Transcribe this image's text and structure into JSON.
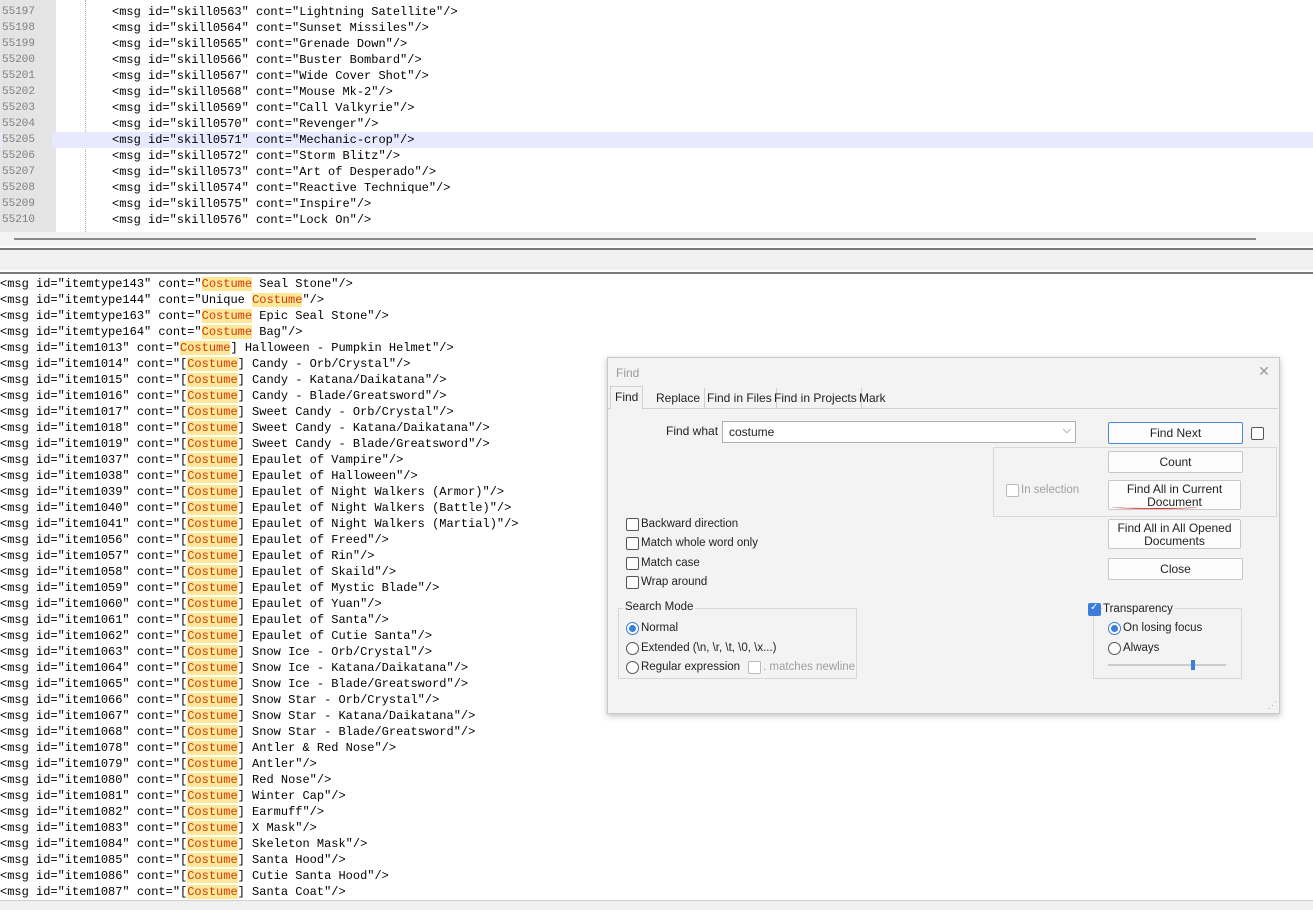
{
  "top_editor": {
    "current_line_index": 8,
    "lines": [
      {
        "num": "55197",
        "code": "<msg id=\"skill0563\" cont=\"Lightning Satellite\"/>"
      },
      {
        "num": "55198",
        "code": "<msg id=\"skill0564\" cont=\"Sunset Missiles\"/>"
      },
      {
        "num": "55199",
        "code": "<msg id=\"skill0565\" cont=\"Grenade Down\"/>"
      },
      {
        "num": "55200",
        "code": "<msg id=\"skill0566\" cont=\"Buster Bombard\"/>"
      },
      {
        "num": "55201",
        "code": "<msg id=\"skill0567\" cont=\"Wide Cover Shot\"/>"
      },
      {
        "num": "55202",
        "code": "<msg id=\"skill0568\" cont=\"Mouse Mk-2\"/>"
      },
      {
        "num": "55203",
        "code": "<msg id=\"skill0569\" cont=\"Call Valkyrie\"/>"
      },
      {
        "num": "55204",
        "code": "<msg id=\"skill0570\" cont=\"Revenger\"/>"
      },
      {
        "num": "55205",
        "code": "<msg id=\"skill0571\" cont=\"Mechanic-crop\"/>"
      },
      {
        "num": "55206",
        "code": "<msg id=\"skill0572\" cont=\"Storm Blitz\"/>"
      },
      {
        "num": "55207",
        "code": "<msg id=\"skill0573\" cont=\"Art of Desperado\"/>"
      },
      {
        "num": "55208",
        "code": "<msg id=\"skill0574\" cont=\"Reactive Technique\"/>"
      },
      {
        "num": "55209",
        "code": "<msg id=\"skill0575\" cont=\"Inspire\"/>"
      },
      {
        "num": "55210",
        "code": "<msg id=\"skill0576\" cont=\"Lock On\"/>"
      }
    ]
  },
  "results": {
    "lines": [
      {
        "pre": "<msg id=\"itemtype143\" cont=\"",
        "match": "Costume",
        "post": " Seal Stone\"/>"
      },
      {
        "pre": "<msg id=\"itemtype144\" cont=\"Unique ",
        "match": "Costume",
        "post": "\"/>"
      },
      {
        "pre": "<msg id=\"itemtype163\" cont=\"",
        "match": "Costume",
        "post": " Epic Seal Stone\"/>"
      },
      {
        "pre": "<msg id=\"itemtype164\" cont=\"",
        "match": "Costume",
        "post": " Bag\"/>"
      },
      {
        "pre": "<msg id=\"item1013\" cont=\"",
        "match": "Costume",
        "post": "] Halloween - Pumpkin Helmet\"/>"
      },
      {
        "pre": "<msg id=\"item1014\" cont=\"[",
        "match": "Costume",
        "post": "] Candy - Orb/Crystal\"/>"
      },
      {
        "pre": "<msg id=\"item1015\" cont=\"[",
        "match": "Costume",
        "post": "] Candy - Katana/Daikatana\"/>"
      },
      {
        "pre": "<msg id=\"item1016\" cont=\"[",
        "match": "Costume",
        "post": "] Candy - Blade/Greatsword\"/>"
      },
      {
        "pre": "<msg id=\"item1017\" cont=\"[",
        "match": "Costume",
        "post": "] Sweet Candy - Orb/Crystal\"/>"
      },
      {
        "pre": "<msg id=\"item1018\" cont=\"[",
        "match": "Costume",
        "post": "] Sweet Candy - Katana/Daikatana\"/>"
      },
      {
        "pre": "<msg id=\"item1019\" cont=\"[",
        "match": "Costume",
        "post": "] Sweet Candy - Blade/Greatsword\"/>"
      },
      {
        "pre": "<msg id=\"item1037\" cont=\"[",
        "match": "Costume",
        "post": "] Epaulet of Vampire\"/>"
      },
      {
        "pre": "<msg id=\"item1038\" cont=\"[",
        "match": "Costume",
        "post": "] Epaulet of Halloween\"/>"
      },
      {
        "pre": "<msg id=\"item1039\" cont=\"[",
        "match": "Costume",
        "post": "] Epaulet of Night Walkers (Armor)\"/>"
      },
      {
        "pre": "<msg id=\"item1040\" cont=\"[",
        "match": "Costume",
        "post": "] Epaulet of Night Walkers (Battle)\"/>"
      },
      {
        "pre": "<msg id=\"item1041\" cont=\"[",
        "match": "Costume",
        "post": "] Epaulet of Night Walkers (Martial)\"/>"
      },
      {
        "pre": "<msg id=\"item1056\" cont=\"[",
        "match": "Costume",
        "post": "] Epaulet of Freed\"/>"
      },
      {
        "pre": "<msg id=\"item1057\" cont=\"[",
        "match": "Costume",
        "post": "] Epaulet of Rin\"/>"
      },
      {
        "pre": "<msg id=\"item1058\" cont=\"[",
        "match": "Costume",
        "post": "] Epaulet of Skaild\"/>"
      },
      {
        "pre": "<msg id=\"item1059\" cont=\"[",
        "match": "Costume",
        "post": "] Epaulet of Mystic Blade\"/>"
      },
      {
        "pre": "<msg id=\"item1060\" cont=\"[",
        "match": "Costume",
        "post": "] Epaulet of Yuan\"/>"
      },
      {
        "pre": "<msg id=\"item1061\" cont=\"[",
        "match": "Costume",
        "post": "] Epaulet of Santa\"/>"
      },
      {
        "pre": "<msg id=\"item1062\" cont=\"[",
        "match": "Costume",
        "post": "] Epaulet of Cutie Santa\"/>"
      },
      {
        "pre": "<msg id=\"item1063\" cont=\"[",
        "match": "Costume",
        "post": "] Snow Ice - Orb/Crystal\"/>"
      },
      {
        "pre": "<msg id=\"item1064\" cont=\"[",
        "match": "Costume",
        "post": "] Snow Ice - Katana/Daikatana\"/>"
      },
      {
        "pre": "<msg id=\"item1065\" cont=\"[",
        "match": "Costume",
        "post": "] Snow Ice - Blade/Greatsword\"/>"
      },
      {
        "pre": "<msg id=\"item1066\" cont=\"[",
        "match": "Costume",
        "post": "] Snow Star - Orb/Crystal\"/>"
      },
      {
        "pre": "<msg id=\"item1067\" cont=\"[",
        "match": "Costume",
        "post": "] Snow Star - Katana/Daikatana\"/>"
      },
      {
        "pre": "<msg id=\"item1068\" cont=\"[",
        "match": "Costume",
        "post": "] Snow Star - Blade/Greatsword\"/>"
      },
      {
        "pre": "<msg id=\"item1078\" cont=\"[",
        "match": "Costume",
        "post": "] Antler & Red Nose\"/>"
      },
      {
        "pre": "<msg id=\"item1079\" cont=\"[",
        "match": "Costume",
        "post": "] Antler\"/>"
      },
      {
        "pre": "<msg id=\"item1080\" cont=\"[",
        "match": "Costume",
        "post": "] Red Nose\"/>"
      },
      {
        "pre": "<msg id=\"item1081\" cont=\"[",
        "match": "Costume",
        "post": "] Winter Cap\"/>"
      },
      {
        "pre": "<msg id=\"item1082\" cont=\"[",
        "match": "Costume",
        "post": "] Earmuff\"/>"
      },
      {
        "pre": "<msg id=\"item1083\" cont=\"[",
        "match": "Costume",
        "post": "] X Mask\"/>"
      },
      {
        "pre": "<msg id=\"item1084\" cont=\"[",
        "match": "Costume",
        "post": "] Skeleton Mask\"/>"
      },
      {
        "pre": "<msg id=\"item1085\" cont=\"[",
        "match": "Costume",
        "post": "] Santa Hood\"/>"
      },
      {
        "pre": "<msg id=\"item1086\" cont=\"[",
        "match": "Costume",
        "post": "] Cutie Santa Hood\"/>"
      },
      {
        "pre": "<msg id=\"item1087\" cont=\"[",
        "match": "Costume",
        "post": "] Santa Coat\"/>"
      }
    ]
  },
  "find_dialog": {
    "title": "Find",
    "close_icon": "close-icon",
    "tabs": [
      "Find",
      "Replace",
      "Find in Files",
      "Find in Projects",
      "Mark"
    ],
    "active_tab": "Find",
    "find_what_label": "Find what :",
    "find_what_value": "costume",
    "buttons": {
      "find_next": "Find Next",
      "count": "Count",
      "find_all_current_line1": "Find All in Current",
      "find_all_current_line2": "Document",
      "find_all_opened_line1": "Find All in All Opened",
      "find_all_opened_line2": "Documents",
      "close": "Close"
    },
    "in_selection_label": "In selection",
    "options": {
      "backward": {
        "label": "Backward direction",
        "checked": false
      },
      "whole_word": {
        "label": "Match whole word only",
        "checked": false
      },
      "match_case": {
        "label": "Match case",
        "checked": false
      },
      "wrap_around": {
        "label": "Wrap around",
        "checked": false
      }
    },
    "search_mode": {
      "title": "Search Mode",
      "normal": "Normal",
      "extended": "Extended (\\n, \\r, \\t, \\0, \\x...)",
      "regex": "Regular expression",
      "matches_newline": ". matches newline",
      "selected": "Normal"
    },
    "transparency": {
      "label": "Transparency",
      "checked": true,
      "on_losing_focus": "On losing focus",
      "always": "Always",
      "selected": "On losing focus",
      "slider_level": 0.72
    }
  },
  "colors": {
    "match_bg": "#fde89a",
    "match_fg": "#d23b00",
    "current_line": "#e8e8ff",
    "accent": "#3b7dd8"
  }
}
